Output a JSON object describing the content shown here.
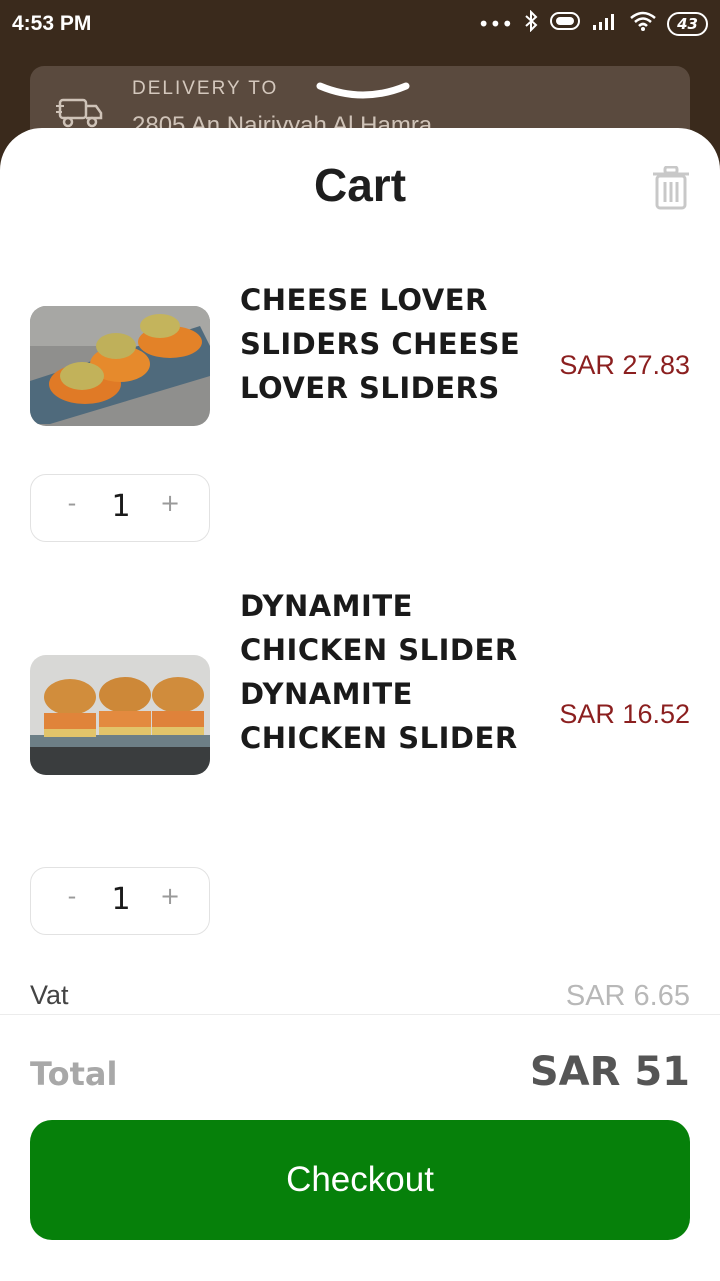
{
  "status_bar": {
    "time": "4:53 PM",
    "battery": "43"
  },
  "delivery": {
    "label": "DELIVERY TO",
    "address": "2805 An Nairiyyah Al Hamra"
  },
  "cart": {
    "title": "Cart",
    "items": [
      {
        "name": "CHEESE LOVER SLIDERS CHEESE LOVER SLIDERS",
        "price": "SAR 27.83",
        "qty": "1",
        "minus": "-",
        "plus": "+"
      },
      {
        "name": "DYNAMITE CHICKEN SLIDER DYNAMITE CHICKEN SLIDER",
        "price": "SAR 16.52",
        "qty": "1",
        "minus": "-",
        "plus": "+"
      }
    ],
    "vat_label": "Vat",
    "vat_value": "SAR 6.65",
    "total_label": "Total",
    "total_value": "SAR 51",
    "checkout_label": "Checkout"
  },
  "colors": {
    "accent_green": "#06800a",
    "price_red": "#8b1f1f",
    "header_brown": "#3a2a1c"
  }
}
